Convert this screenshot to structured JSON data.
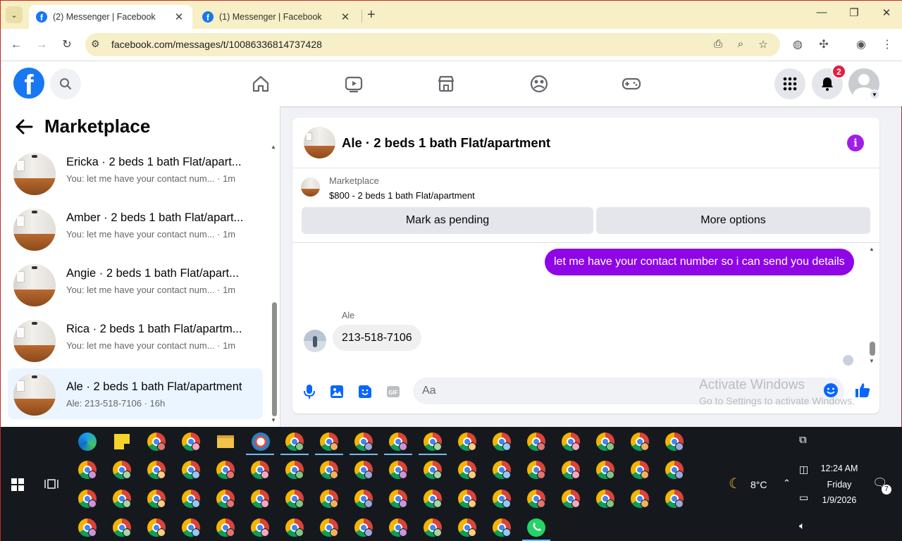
{
  "browser": {
    "tabs": [
      {
        "title": "(2) Messenger | Facebook",
        "active": true
      },
      {
        "title": "(1) Messenger | Facebook",
        "active": false
      }
    ],
    "url": "facebook.com/messages/t/10086336814737428"
  },
  "facebook": {
    "notification_count": "2"
  },
  "sidebar": {
    "title": "Marketplace",
    "conversations": [
      {
        "name": "Ericka · 2 beds 1 bath Flat/apart...",
        "preview": "You: let me have your contact num... · 1m",
        "selected": false
      },
      {
        "name": "Amber · 2 beds 1 bath Flat/apart...",
        "preview": "You: let me have your contact num... · 1m",
        "selected": false
      },
      {
        "name": "Angie · 2 beds 1 bath Flat/apart...",
        "preview": "You: let me have your contact num... · 1m",
        "selected": false
      },
      {
        "name": "Rica · 2 beds 1 bath Flat/apartm...",
        "preview": "You: let me have your contact num... · 1m",
        "selected": false
      },
      {
        "name": "Ale · 2 beds 1 bath Flat/apartment",
        "preview": "Ale: 213-518-7106 · 16h",
        "selected": true
      }
    ]
  },
  "chat": {
    "title": "Ale · 2 beds 1 bath Flat/apartment",
    "listing_source": "Marketplace",
    "listing_price": "$800 - 2 beds 1 bath Flat/apartment",
    "btn_pending": "Mark as pending",
    "btn_more": "More options",
    "messages": {
      "outgoing": "let me have your contact number so i can send you details",
      "sender": "Ale",
      "incoming": "213-518-7106"
    },
    "composer_placeholder": "Aa"
  },
  "watermark": {
    "line1": "Activate Windows",
    "line2": "Go to Settings to activate Windows."
  },
  "taskbar": {
    "weather_temp": "8°C",
    "time": "12:24 AM",
    "day": "Friday",
    "date": "1/9/2026",
    "notification_count": "7"
  },
  "colors": {
    "facebook_blue": "#1877f2",
    "messenger_purple": "#8e06e6",
    "notification_red": "#e41e3f",
    "selected_conversation": "#ebf5ff"
  }
}
